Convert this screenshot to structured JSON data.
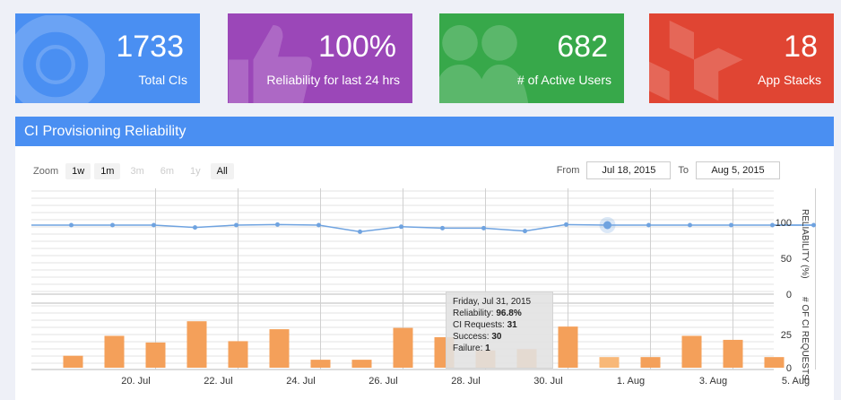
{
  "tiles": [
    {
      "value": "1733",
      "label": "Total CIs",
      "icon": "lifebuoy-icon",
      "color": "#4a8ff2"
    },
    {
      "value": "100%",
      "label": "Reliability for last 24 hrs",
      "icon": "thumbs-up-icon",
      "color": "#9b47b8"
    },
    {
      "value": "682",
      "label": "# of Active Users",
      "icon": "users-icon",
      "color": "#37a84a"
    },
    {
      "value": "18",
      "label": "App Stacks",
      "icon": "cubes-icon",
      "color": "#e04533"
    }
  ],
  "panel": {
    "title": "CI Provisioning Reliability"
  },
  "zoom": {
    "label": "Zoom",
    "buttons": [
      "1w",
      "1m",
      "3m",
      "6m",
      "1y",
      "All"
    ],
    "disabled": [
      "3m",
      "6m",
      "1y"
    ]
  },
  "range": {
    "from_label": "From",
    "from": "Jul 18, 2015",
    "to_label": "To",
    "to": "Aug 5, 2015"
  },
  "tooltip": {
    "date": "Friday, Jul 31, 2015",
    "reliability_label": "Reliability:",
    "reliability": "96.8%",
    "requests_label": "CI Requests:",
    "requests": "31",
    "success_label": "Success:",
    "success": "30",
    "failure_label": "Failure:",
    "failure": "1"
  },
  "chart_data": {
    "type": "line+bar",
    "x_ticks": [
      "20. Jul",
      "22. Jul",
      "24. Jul",
      "26. Jul",
      "28. Jul",
      "30. Jul",
      "1. Aug",
      "3. Aug",
      "5. Aug"
    ],
    "dates": [
      "Jul 18",
      "Jul 19",
      "Jul 20",
      "Jul 21",
      "Jul 22",
      "Jul 23",
      "Jul 24",
      "Jul 25",
      "Jul 26",
      "Jul 27",
      "Jul 28",
      "Jul 29",
      "Jul 30",
      "Jul 31",
      "Aug 1",
      "Aug 2",
      "Aug 3",
      "Aug 4",
      "Aug 5"
    ],
    "reliability": [
      100,
      100,
      100,
      93,
      100,
      97,
      100,
      87,
      94,
      92,
      92,
      88,
      97,
      100,
      100,
      100,
      100,
      100,
      100
    ],
    "requests": [
      9,
      24,
      19,
      35,
      20,
      29,
      6,
      6,
      30,
      23,
      13,
      14,
      31,
      8,
      8,
      24,
      21,
      8
    ],
    "reliability_axis": {
      "label": "RELIABILITY (%)",
      "ticks": [
        "100",
        "50",
        "0"
      ]
    },
    "requests_axis": {
      "label": "# OF CI REQUESTS",
      "ticks": [
        "25",
        "0"
      ]
    },
    "highlight": "Jul 31",
    "line_color": "#6fa3e0",
    "bar_color": "#f4a05a",
    "highlight_bar_color": "#f8b878"
  }
}
